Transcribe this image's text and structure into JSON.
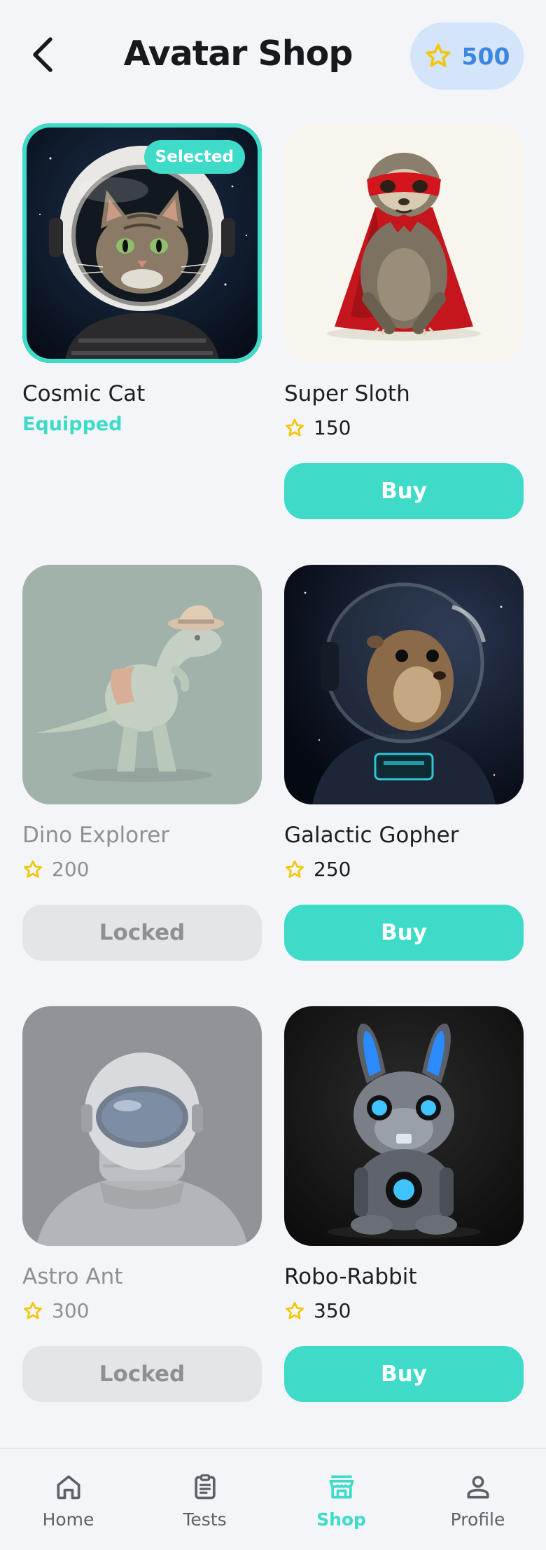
{
  "header": {
    "title": "Avatar Shop",
    "coins": "500",
    "back_icon": "chevron-left-icon",
    "coin_icon": "star-icon"
  },
  "colors": {
    "accent": "#3edbc8",
    "coin_pill_bg": "#d4e5f9",
    "coin_text": "#3b86e0",
    "star": "#f2c60b"
  },
  "avatars": [
    {
      "name": "Cosmic Cat",
      "status": "Equipped",
      "badge": "Selected"
    },
    {
      "name": "Super Sloth",
      "price": "150",
      "button": "Buy"
    },
    {
      "name": "Dino Explorer",
      "price": "200",
      "button": "Locked"
    },
    {
      "name": "Galactic Gopher",
      "price": "250",
      "button": "Buy"
    },
    {
      "name": "Astro Ant",
      "price": "300",
      "button": "Locked"
    },
    {
      "name": "Robo-Rabbit",
      "price": "350",
      "button": "Buy"
    }
  ],
  "nav": [
    {
      "label": "Home",
      "icon": "home-icon"
    },
    {
      "label": "Tests",
      "icon": "clipboard-icon"
    },
    {
      "label": "Shop",
      "icon": "store-icon",
      "active": true
    },
    {
      "label": "Profile",
      "icon": "person-icon"
    }
  ]
}
